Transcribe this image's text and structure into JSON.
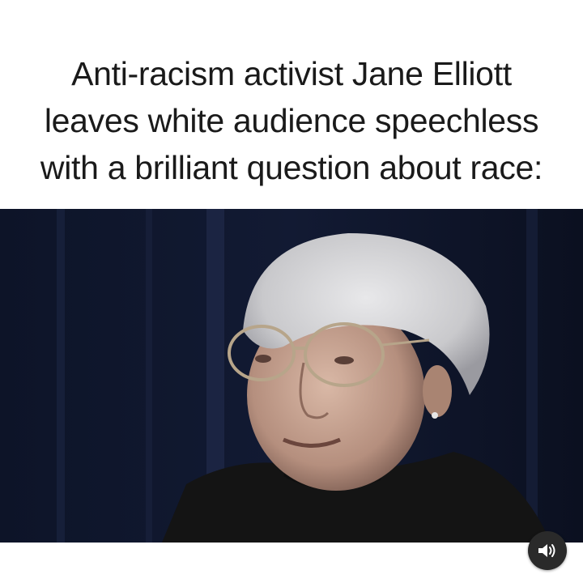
{
  "caption": {
    "line1": "Anti-racism activist Jane Elliott",
    "line2": "leaves white audience speechless",
    "line3": "with a brilliant question about race:"
  },
  "video": {
    "sound_icon": "speaker-icon"
  },
  "colors": {
    "caption_text": "#1a1a1a",
    "video_background": "#0b1020",
    "sound_button_bg": "#2a2a2a"
  }
}
